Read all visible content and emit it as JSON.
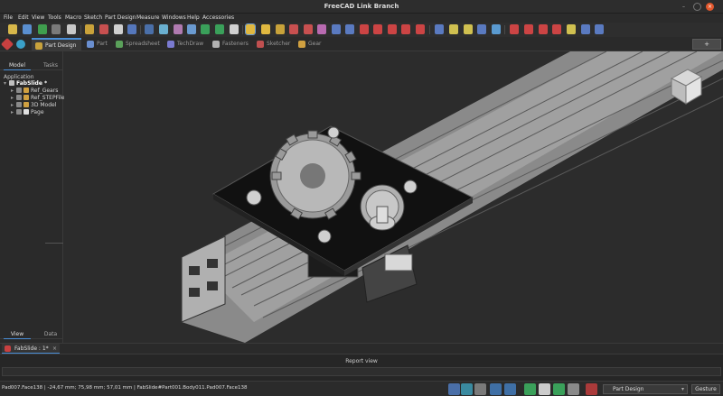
{
  "window": {
    "title": "FreeCAD Link Branch",
    "min": "–",
    "max": "",
    "close": "×"
  },
  "menu": [
    "File",
    "Edit",
    "View",
    "Tools",
    "Macro",
    "Sketch",
    "Part Design",
    "Measure",
    "Windows",
    "Help",
    "Accessories"
  ],
  "workbench_tabs": [
    {
      "label": "Part Design",
      "color": "#c8a23c"
    },
    {
      "label": "Part",
      "color": "#6a8fd0"
    },
    {
      "label": "Spreadsheet",
      "color": "#5aa05a"
    },
    {
      "label": "TechDraw",
      "color": "#7a7ad0"
    },
    {
      "label": "Fasteners",
      "color": "#b0b0b0"
    },
    {
      "label": "Sketcher",
      "color": "#c05050"
    },
    {
      "label": "Gear",
      "color": "#d0a040"
    }
  ],
  "right_button": "+",
  "combo": {
    "tabs": [
      "Model",
      "Tasks"
    ],
    "tree_header": "Application",
    "tree": [
      {
        "label": "FabSlide *",
        "bold": true,
        "indent": 0,
        "arrow": "▾",
        "color": "#c0c0c0"
      },
      {
        "label": "Ref_Gears",
        "bold": false,
        "indent": 1,
        "arrow": "▸",
        "color": "#d0a040"
      },
      {
        "label": "Ref_STEPFiles",
        "bold": false,
        "indent": 1,
        "arrow": "▸",
        "color": "#d0a040"
      },
      {
        "label": "3D Model",
        "bold": false,
        "indent": 1,
        "arrow": "▸",
        "color": "#d0a040"
      },
      {
        "label": "Page",
        "bold": false,
        "indent": 1,
        "arrow": "▸",
        "color": "#e0e0e0"
      }
    ],
    "bottom_tabs": [
      "View",
      "Data"
    ]
  },
  "document_tab": {
    "label": "FabSlide : 1*",
    "close": "×"
  },
  "report_view": {
    "label": "Report view"
  },
  "status": {
    "message": "Pad007.Face138 | -24,67 mm; 75,98 mm; 57,01 mm | FabSlide#Part001.Body011.Pad007.Face138",
    "workbench": "Part Design",
    "caret": "▾",
    "gesture": "Gesture"
  },
  "colors": {
    "accent": "#4a8fd8",
    "close_button": "#e2572c"
  }
}
